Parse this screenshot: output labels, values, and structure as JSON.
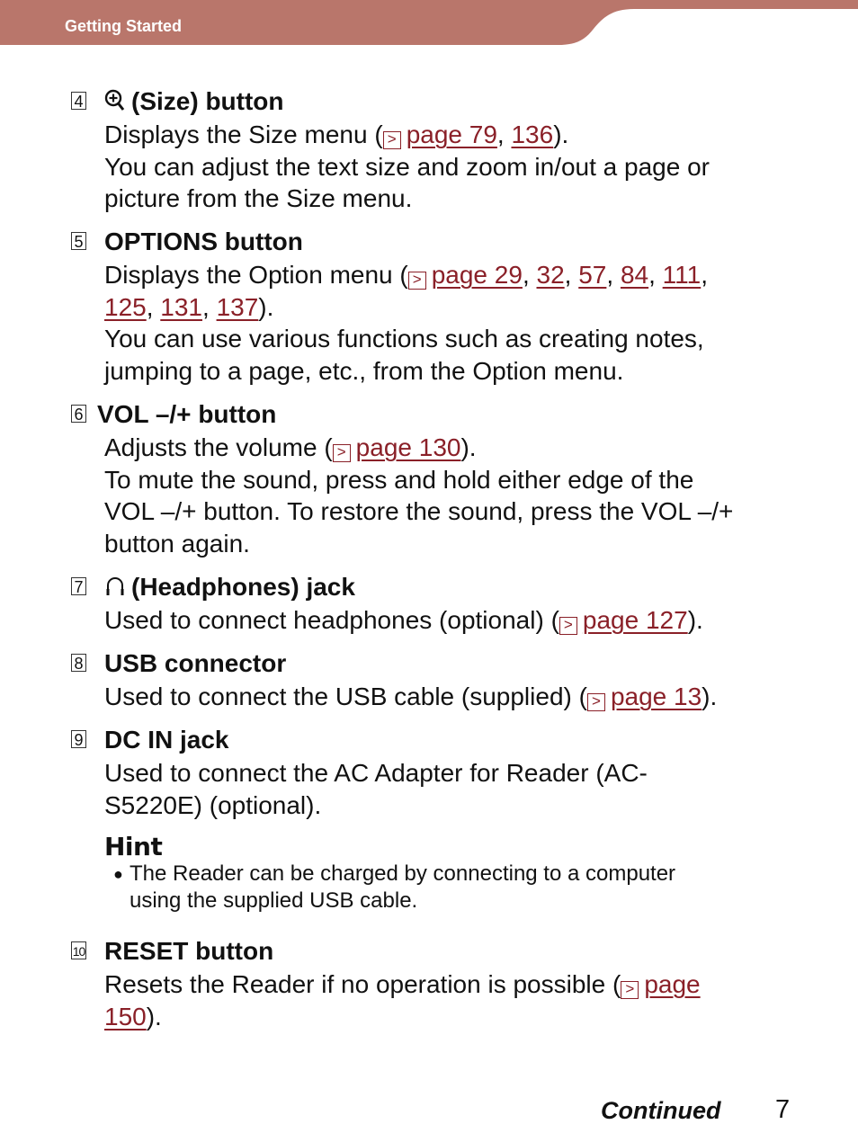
{
  "header": {
    "section_title": "Getting Started",
    "bar_color": "#b9766b"
  },
  "link_color": "#8a2028",
  "items": [
    {
      "number": "4",
      "icon": "zoom-in-icon",
      "title": "(Size) button",
      "lines": [
        {
          "pre": "Displays the Size menu (",
          "links": [
            "page 79",
            "136"
          ],
          "post": ")."
        },
        {
          "text": "You can adjust the text size and zoom in/out a page or"
        },
        {
          "text": "picture from the Size menu."
        }
      ]
    },
    {
      "number": "5",
      "title": "OPTIONS button",
      "lines": [
        {
          "pre": "Displays the Option menu (",
          "links": [
            "page 29",
            "32",
            "57",
            "84",
            "111"
          ],
          "post": ","
        },
        {
          "links": [
            "125",
            "131",
            "137"
          ],
          "post": ")."
        },
        {
          "text": "You can use various functions such as creating notes,"
        },
        {
          "text": "jumping to a page, etc., from the Option menu."
        }
      ]
    },
    {
      "number": "6",
      "title": "VOL –/+ button",
      "lines": [
        {
          "pre": "Adjusts the volume (",
          "links": [
            "page 130"
          ],
          "post": ")."
        },
        {
          "text": "To mute the sound, press and hold either edge of the"
        },
        {
          "text": "VOL –/+ button. To restore the sound, press the VOL –/+"
        },
        {
          "text": "button again."
        }
      ]
    },
    {
      "number": "7",
      "icon": "headphones-icon",
      "title": "(Headphones) jack",
      "lines": [
        {
          "pre": "Used to connect headphones (optional) (",
          "links": [
            "page 127"
          ],
          "post": ")."
        }
      ]
    },
    {
      "number": "8",
      "title": "USB connector",
      "lines": [
        {
          "pre": "Used to connect the USB cable (supplied) (",
          "links": [
            "page 13"
          ],
          "post": ")."
        }
      ]
    },
    {
      "number": "9",
      "title": "DC IN jack",
      "lines": [
        {
          "text": "Used to connect the AC Adapter for Reader (AC-"
        },
        {
          "text": "S5220E) (optional)."
        }
      ]
    },
    {
      "number": "10",
      "title": "RESET button",
      "lines": [
        {
          "pre": "Resets the Reader if no operation is possible (",
          "links": [
            "page "
          ],
          "post": ""
        },
        {
          "links": [
            "150"
          ],
          "post": ")."
        }
      ]
    }
  ],
  "hint": {
    "title": "Hint",
    "bullet": "●",
    "lines": [
      "The Reader can be charged by connecting to a computer",
      "using the supplied USB cable."
    ]
  },
  "footer": {
    "continued": "Continued",
    "page_number": "7"
  },
  "ref_icon_glyph": ">"
}
